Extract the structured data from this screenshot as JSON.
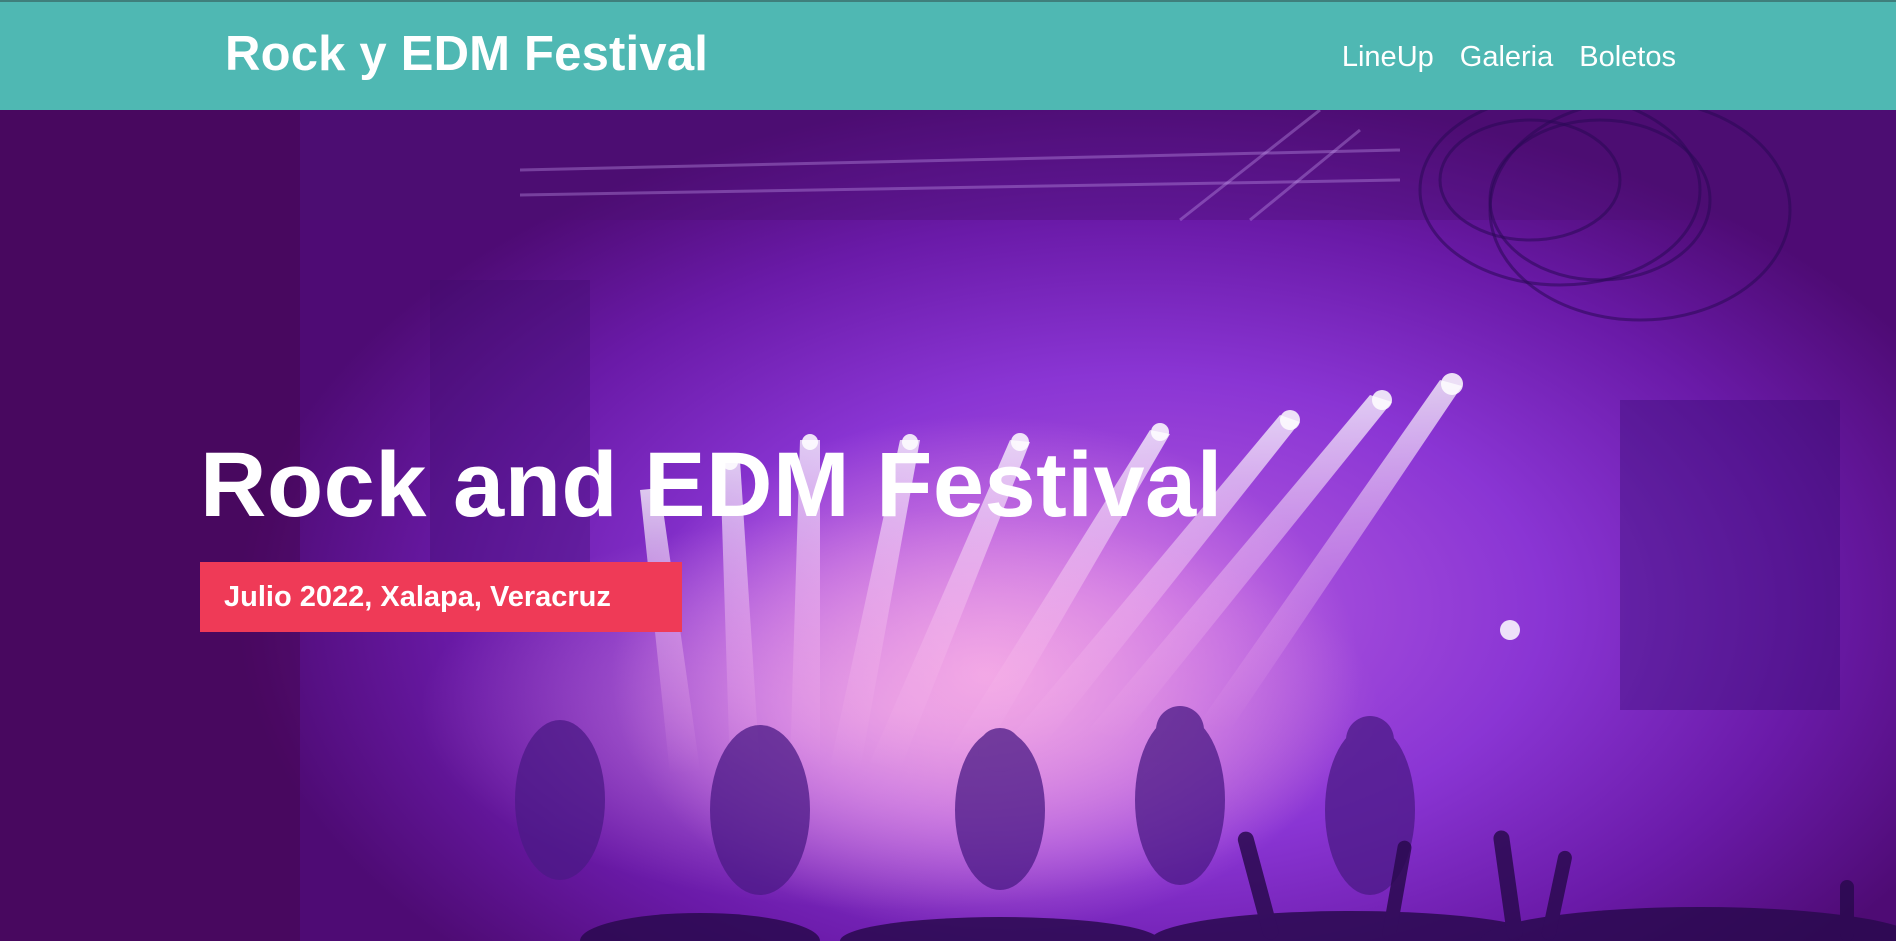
{
  "header": {
    "brand": "Rock y EDM Festival",
    "nav": [
      {
        "label": "LineUp"
      },
      {
        "label": "Galeria"
      },
      {
        "label": "Boletos"
      }
    ],
    "background_color": "#4fb8b3"
  },
  "hero": {
    "title": "Rock and EDM Festival",
    "date_badge": "Julio 2022, Xalapa, Veracruz",
    "badge_color": "#ef3a57",
    "background_image": "concert-stage-with-purple-lights"
  }
}
